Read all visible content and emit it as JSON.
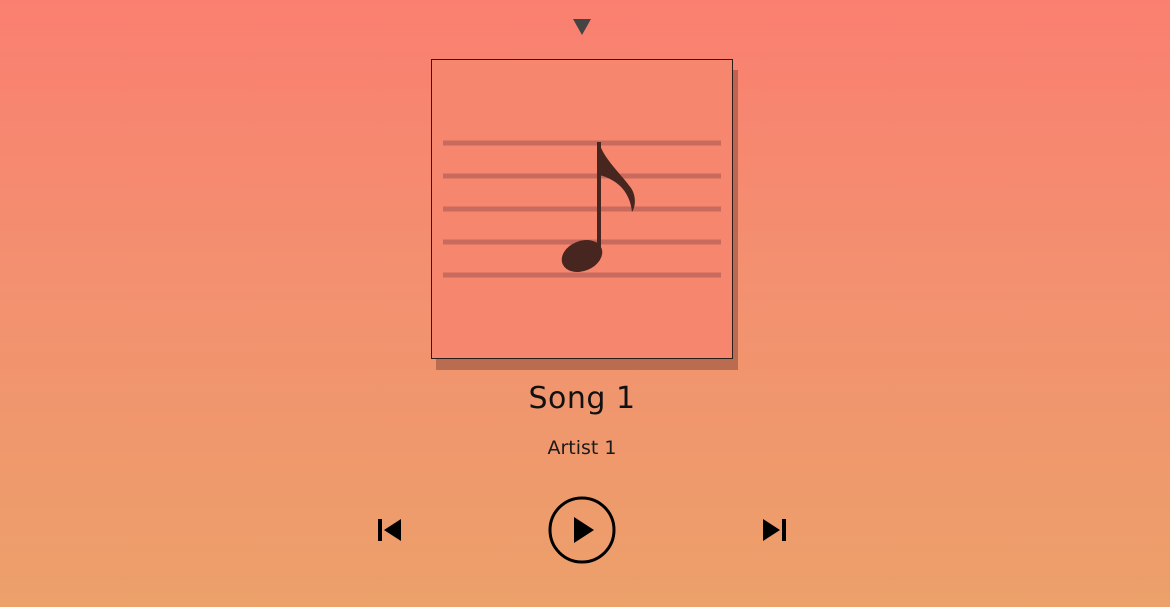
{
  "player": {
    "song_title": "Song 1",
    "artist": "Artist 1"
  },
  "icons": {
    "collapse": "triangle-down-icon",
    "album_art": "music-note-icon",
    "previous": "skip-previous-icon",
    "play": "play-icon",
    "next": "skip-next-icon"
  },
  "colors": {
    "gradient_top": "#fa7f70",
    "gradient_bottom": "#eca06a",
    "note": "#472620",
    "staff_lines": "#c96a5e",
    "controls": "#000000"
  }
}
